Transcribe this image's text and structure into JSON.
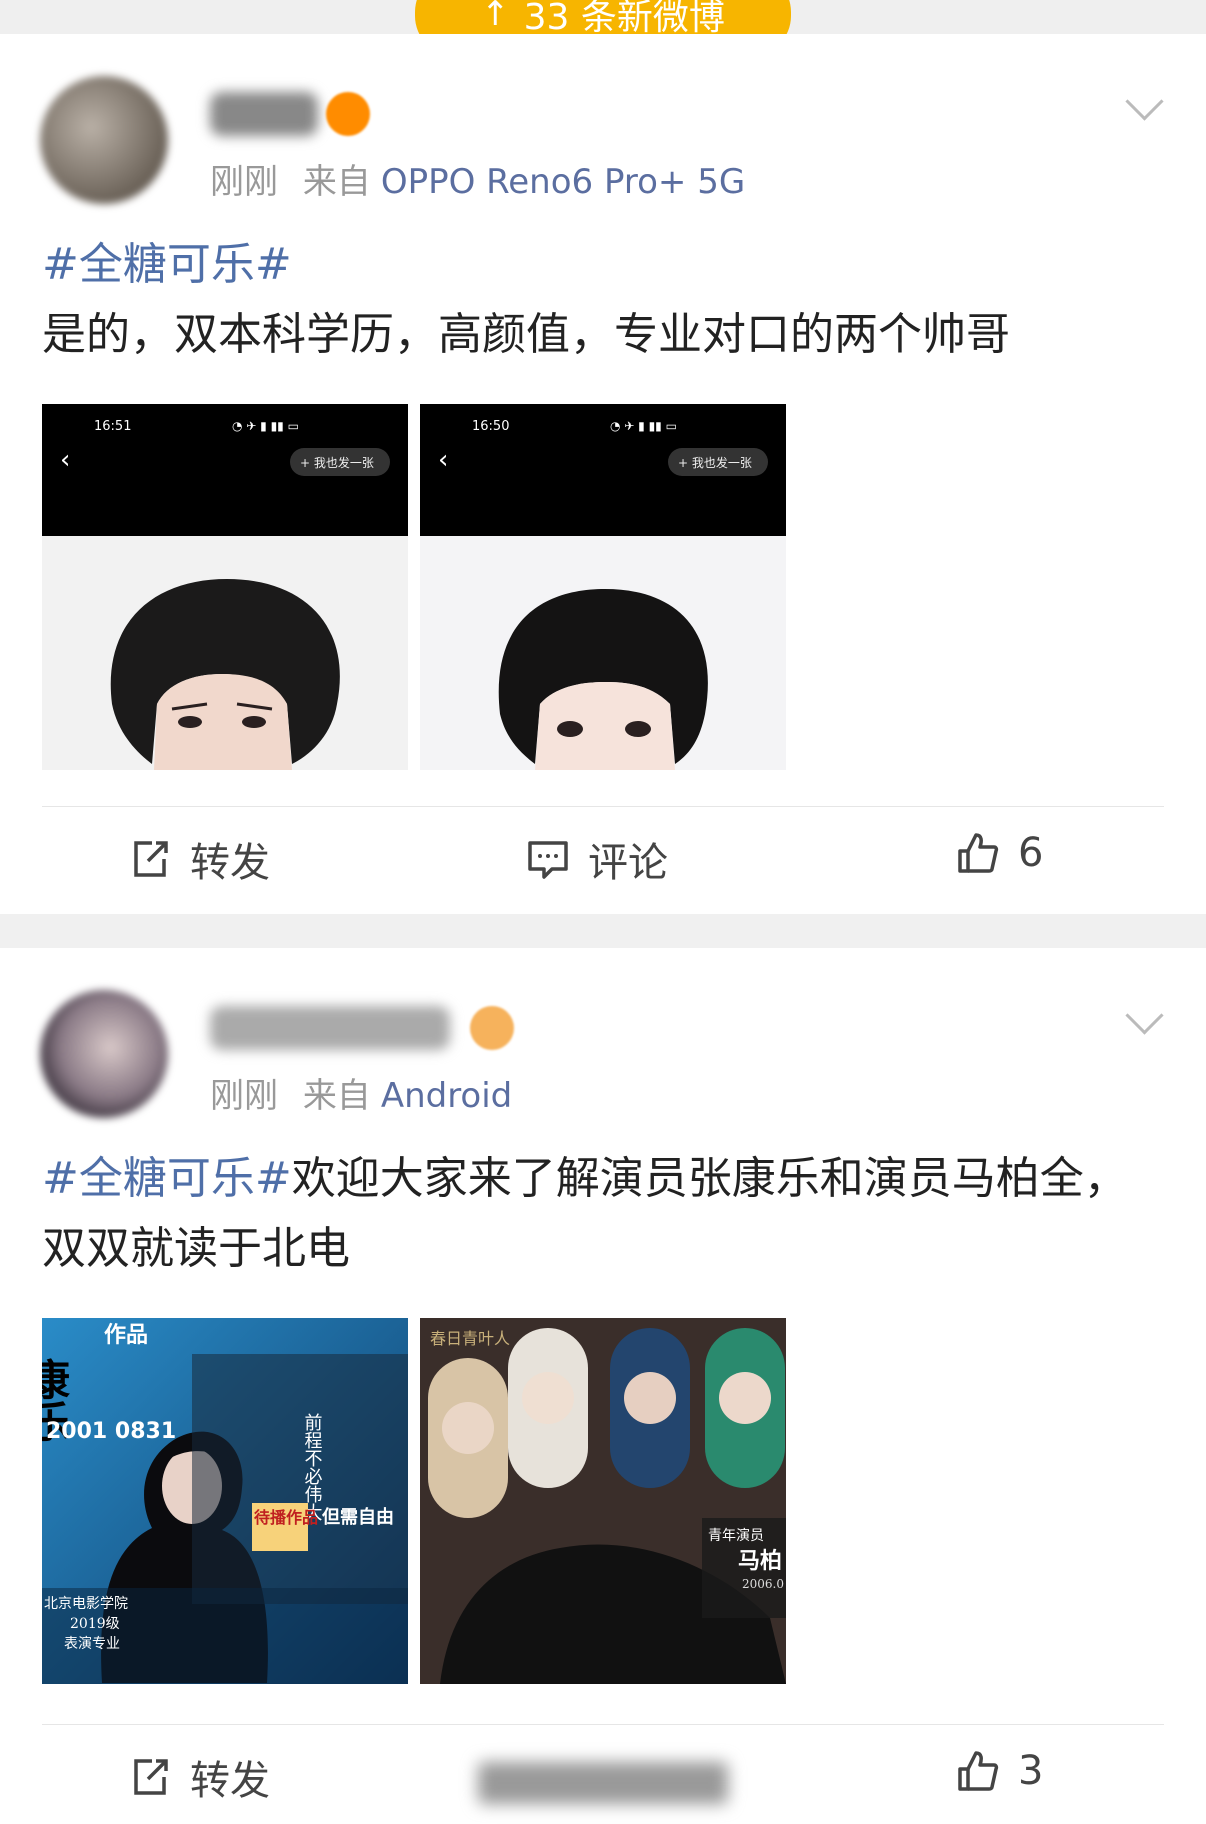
{
  "banner": {
    "new_posts": "33 条新微博",
    "arrow": "↑"
  },
  "posts": [
    {
      "meta_time": "刚刚",
      "meta_from": "来自",
      "meta_device": "OPPO Reno6 Pro+ 5G",
      "hashtag": "#全糖可乐#",
      "body": "是的，双本科学历，高颜值，专业对口的两个帅哥",
      "images": [
        {
          "status_time": "16:51",
          "action": "+ 我也发一张"
        },
        {
          "status_time": "16:50",
          "action": "+ 我也发一张"
        }
      ],
      "actions": {
        "repost": "转发",
        "comment": "评论",
        "likes": "6"
      }
    },
    {
      "meta_time": "刚刚",
      "meta_from": "来自",
      "meta_device": "Android",
      "hashtag": "#全糖可乐#",
      "body": "欢迎大家来了解演员张康乐和演员马柏全，双双就读于北电",
      "images": [
        {
          "big_name": "康乐",
          "born": "2001 0831",
          "school": "北京电影学院",
          "class": "2019级",
          "major": "表演专业",
          "label1": "作品",
          "label2": "前程不必伟大",
          "label3": "待播作品",
          "label4": "但需自由"
        },
        {
          "top_text": "春日青叶人",
          "badge": "青年演员",
          "name": "马柏",
          "year": "2006.0"
        }
      ],
      "actions": {
        "repost": "转发",
        "likes": "3"
      }
    }
  ],
  "colors": {
    "accent": "#f7b500",
    "link": "#4f6fa8"
  }
}
